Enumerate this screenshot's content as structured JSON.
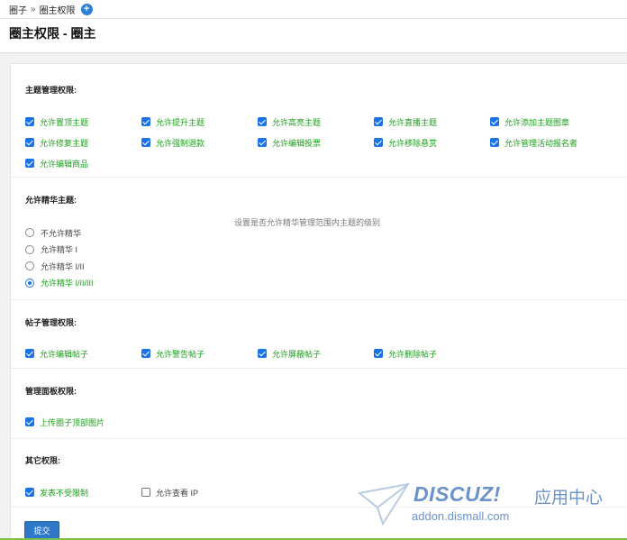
{
  "breadcrumb": {
    "root": "圈子",
    "separator": "»",
    "current": "圈主权限"
  },
  "page_title": "圈主权限 - 圈主",
  "sections": {
    "topic": {
      "title": "主题管理权限:",
      "items": [
        {
          "label": "允许置顶主题",
          "checked": true
        },
        {
          "label": "允许提升主题",
          "checked": true
        },
        {
          "label": "允许高亮主题",
          "checked": true
        },
        {
          "label": "允许直播主题",
          "checked": true
        },
        {
          "label": "允许添加主题图章",
          "checked": true
        },
        {
          "label": "允许修复主题",
          "checked": true
        },
        {
          "label": "允许强制退款",
          "checked": true
        },
        {
          "label": "允许编辑投票",
          "checked": true
        },
        {
          "label": "允许移除悬赏",
          "checked": true
        },
        {
          "label": "允许管理活动报名者",
          "checked": true
        },
        {
          "label": "允许编辑商品",
          "checked": true
        }
      ]
    },
    "digest": {
      "title": "允许精华主题:",
      "hint": "设置是否允许精华管理范围内主题的级别",
      "options": [
        {
          "label": "不允许精华",
          "selected": false
        },
        {
          "label": "允许精华 I",
          "selected": false
        },
        {
          "label": "允许精华 I/II",
          "selected": false
        },
        {
          "label": "允许精华 I/II/III",
          "selected": true
        }
      ]
    },
    "post": {
      "title": "帖子管理权限:",
      "items": [
        {
          "label": "允许编辑帖子",
          "checked": true
        },
        {
          "label": "允许警告帖子",
          "checked": true
        },
        {
          "label": "允许屏蔽帖子",
          "checked": true
        },
        {
          "label": "允许删除帖子",
          "checked": true
        }
      ]
    },
    "panel": {
      "title": "管理面板权限:",
      "items": [
        {
          "label": "上传圈子顶部图片",
          "checked": true
        }
      ]
    },
    "other": {
      "title": "其它权限:",
      "items": [
        {
          "label": "发表不受限制",
          "checked": true
        },
        {
          "label": "允许查看 IP",
          "checked": false
        }
      ]
    }
  },
  "submit_label": "提交",
  "watermark": {
    "brand": "DISCUZ!",
    "cn": "应用中心",
    "url": "addon.dismall.com"
  },
  "colors": {
    "accent": "#1a73e8",
    "checked_text": "#1aa01a",
    "button": "#2f78c9"
  }
}
